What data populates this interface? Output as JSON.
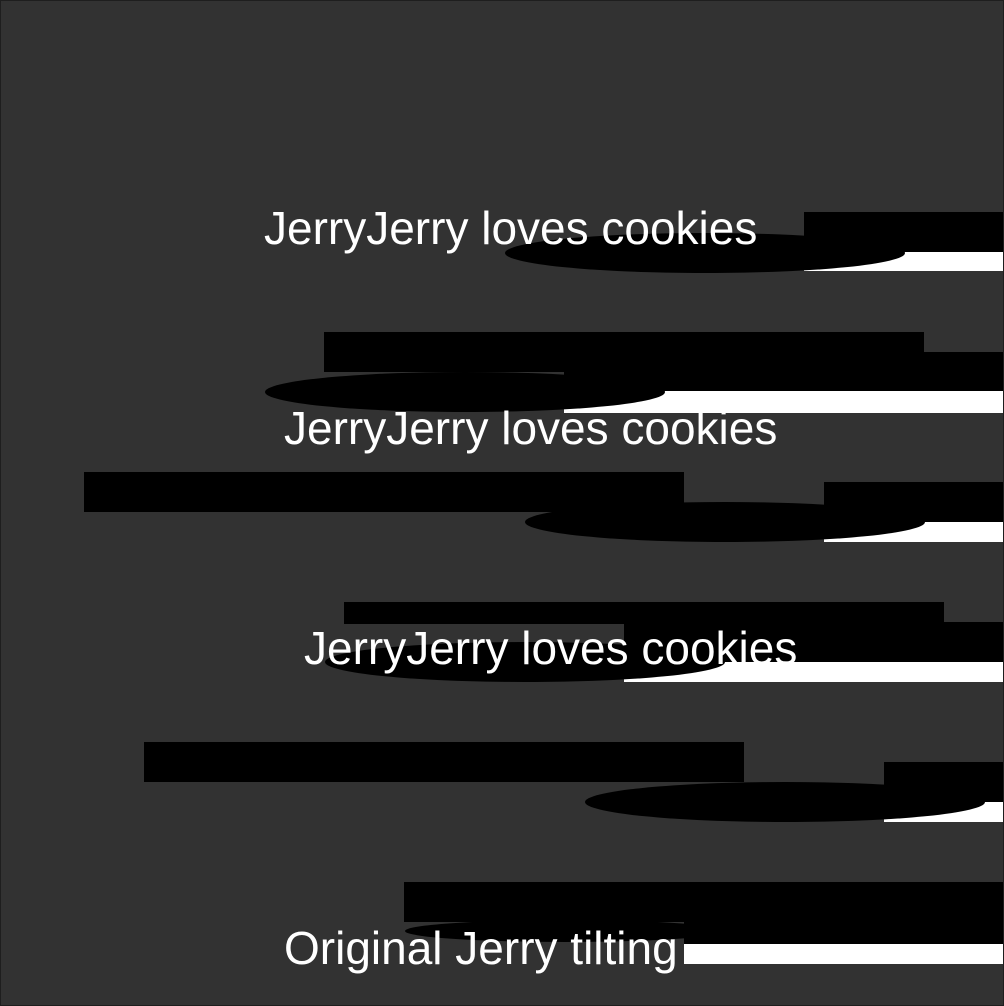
{
  "labels": {
    "line1": "JerryJerry loves cookies",
    "line2": "JerryJerry loves cookies",
    "line3": "JerryJerry loves cookies",
    "caption": "Original Jerry tilting"
  },
  "colors": {
    "background": "#323232",
    "text": "#ffffff",
    "shape_dark": "#000000",
    "shape_light": "#ffffff"
  }
}
